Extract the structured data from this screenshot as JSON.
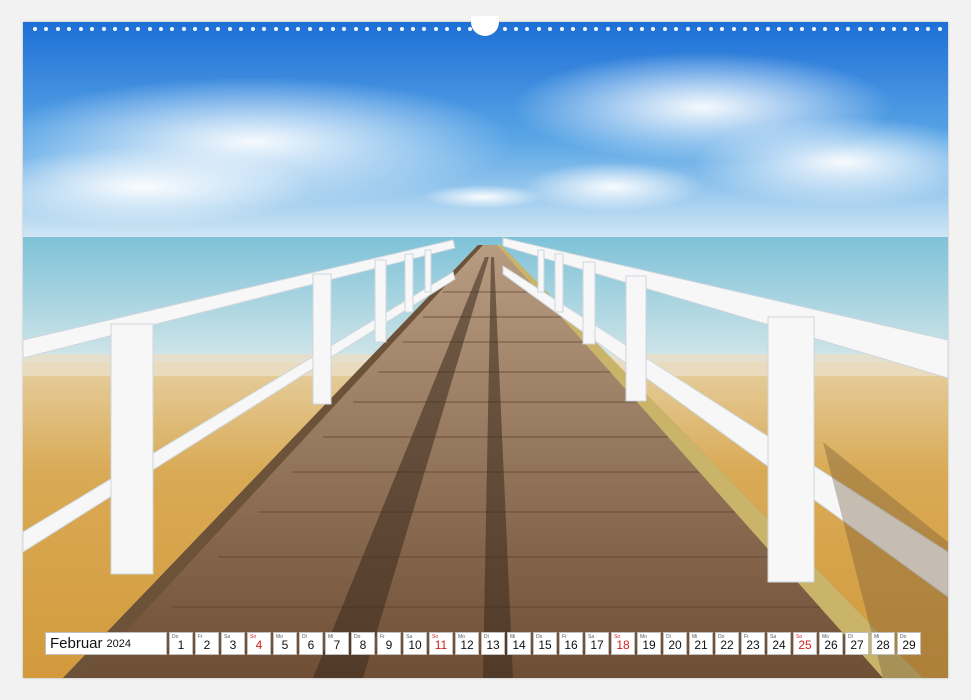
{
  "calendar": {
    "month": "Februar",
    "year": "2024",
    "days": [
      {
        "weekday": "Do",
        "num": "1",
        "sunday": false
      },
      {
        "weekday": "Fr",
        "num": "2",
        "sunday": false
      },
      {
        "weekday": "Sa",
        "num": "3",
        "sunday": false
      },
      {
        "weekday": "So",
        "num": "4",
        "sunday": true
      },
      {
        "weekday": "Mo",
        "num": "5",
        "sunday": false
      },
      {
        "weekday": "Di",
        "num": "6",
        "sunday": false
      },
      {
        "weekday": "Mi",
        "num": "7",
        "sunday": false
      },
      {
        "weekday": "Do",
        "num": "8",
        "sunday": false
      },
      {
        "weekday": "Fr",
        "num": "9",
        "sunday": false
      },
      {
        "weekday": "Sa",
        "num": "10",
        "sunday": false
      },
      {
        "weekday": "So",
        "num": "11",
        "sunday": true
      },
      {
        "weekday": "Mo",
        "num": "12",
        "sunday": false
      },
      {
        "weekday": "Di",
        "num": "13",
        "sunday": false
      },
      {
        "weekday": "Mi",
        "num": "14",
        "sunday": false
      },
      {
        "weekday": "Do",
        "num": "15",
        "sunday": false
      },
      {
        "weekday": "Fr",
        "num": "16",
        "sunday": false
      },
      {
        "weekday": "Sa",
        "num": "17",
        "sunday": false
      },
      {
        "weekday": "So",
        "num": "18",
        "sunday": true
      },
      {
        "weekday": "Mo",
        "num": "19",
        "sunday": false
      },
      {
        "weekday": "Di",
        "num": "20",
        "sunday": false
      },
      {
        "weekday": "Mi",
        "num": "21",
        "sunday": false
      },
      {
        "weekday": "Do",
        "num": "22",
        "sunday": false
      },
      {
        "weekday": "Fr",
        "num": "23",
        "sunday": false
      },
      {
        "weekday": "Sa",
        "num": "24",
        "sunday": false
      },
      {
        "weekday": "So",
        "num": "25",
        "sunday": true
      },
      {
        "weekday": "Mo",
        "num": "26",
        "sunday": false
      },
      {
        "weekday": "Di",
        "num": "27",
        "sunday": false
      },
      {
        "weekday": "Mi",
        "num": "28",
        "sunday": false
      },
      {
        "weekday": "Do",
        "num": "29",
        "sunday": false
      }
    ]
  },
  "colors": {
    "sunday": "#d22020",
    "sky_top": "#1e6fd6",
    "sea": "#8cc4d6",
    "sand": "#d6a455",
    "boards": "#8a6a4a",
    "railing": "#ffffff"
  }
}
